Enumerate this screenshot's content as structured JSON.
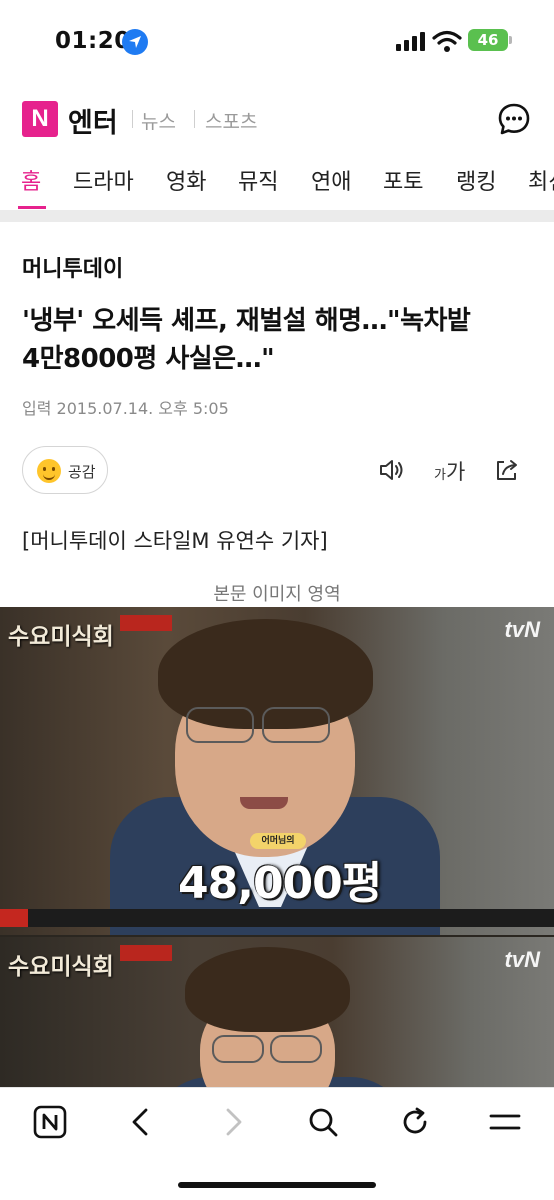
{
  "status_bar": {
    "time": "01:20",
    "battery": "46"
  },
  "header": {
    "logo_letter": "N",
    "section_title": "엔터",
    "nav_links": [
      "뉴스",
      "스포츠"
    ]
  },
  "tabs": [
    {
      "label": "홈",
      "active": true
    },
    {
      "label": "드라마",
      "active": false
    },
    {
      "label": "영화",
      "active": false
    },
    {
      "label": "뮤직",
      "active": false
    },
    {
      "label": "연애",
      "active": false
    },
    {
      "label": "포토",
      "active": false
    },
    {
      "label": "랭킹",
      "active": false
    },
    {
      "label": "최신",
      "active": false
    }
  ],
  "article": {
    "press": "머니투데이",
    "headline_line1": "'냉부' 오세득 셰프, 재벌설 해명…\"녹차밭",
    "headline_line2": "4만8000평 사실은…\"",
    "published": "입력 2015.07.14. 오후 5:05",
    "empathy_label": "공감",
    "font_size_small": "가",
    "font_size_big": "가",
    "byline": "[머니투데이 스타일M 유연수 기자]",
    "image_caption": "본문 이미지 영역"
  },
  "photo": {
    "show_logo": "수요미식회",
    "channel": "tvN",
    "caption_number": "48,000평",
    "caption_tag": "어머님의"
  },
  "toolbar": {
    "buttons": [
      "home",
      "back",
      "forward",
      "search",
      "refresh",
      "menu"
    ]
  },
  "icons": {
    "location": "location-arrow-icon",
    "signal": "cell-signal-icon",
    "wifi": "wifi-icon",
    "chat": "chat-bubble-icon",
    "speaker": "speaker-icon",
    "share": "share-icon"
  },
  "colors": {
    "brand": "#e6228d",
    "location_blue": "#1f7bf2",
    "battery_green": "#5ac04f"
  }
}
